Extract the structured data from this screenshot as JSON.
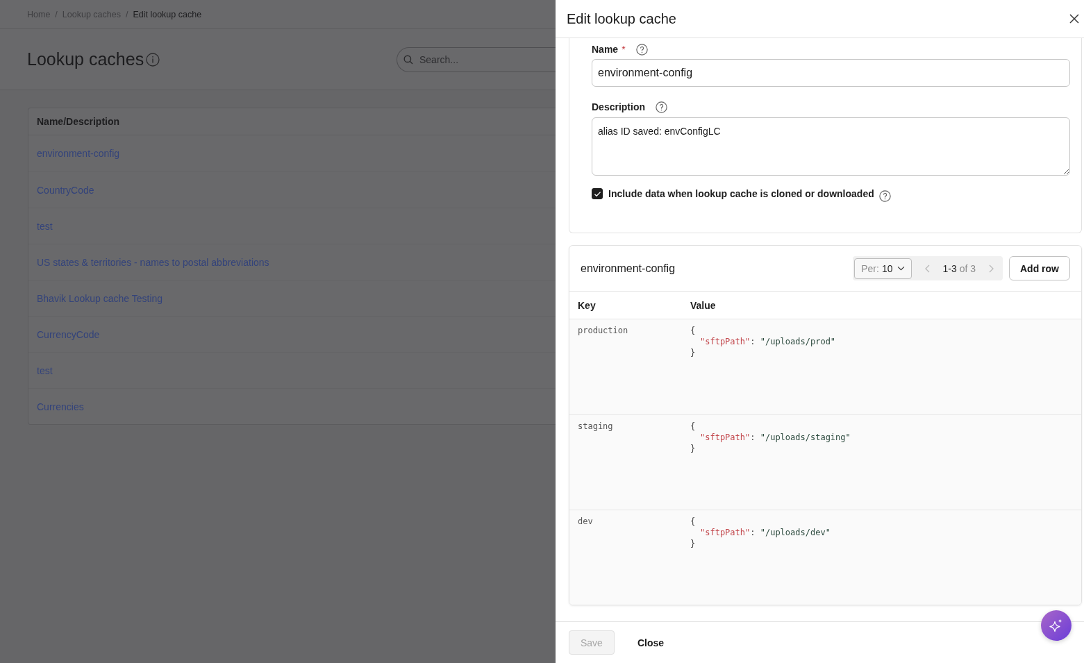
{
  "breadcrumb": {
    "items": [
      {
        "label": "Home",
        "current": false
      },
      {
        "separator": "/",
        "label": "Lookup caches",
        "current": false
      },
      {
        "separator": "/",
        "label": "Edit lookup cache",
        "current": true
      }
    ]
  },
  "page": {
    "title": "Lookup caches",
    "search": {
      "placeholder": "Search..."
    },
    "table": {
      "columns": [
        "Name/Description"
      ],
      "rows": [
        {
          "name": "environment-config"
        },
        {
          "name": "CountryCode"
        },
        {
          "name": "test"
        },
        {
          "name": "US states & territories - names to postal abbreviations"
        },
        {
          "name": "Bhavik Lookup cache Testing"
        },
        {
          "name": "CurrencyCode"
        },
        {
          "name": "test"
        },
        {
          "name": "Currencies"
        }
      ]
    }
  },
  "drawer": {
    "title": "Edit lookup cache",
    "form": {
      "name": {
        "label": "Name",
        "required_mark": "*",
        "value": "environment-config"
      },
      "description": {
        "label": "Description",
        "value": "alias ID saved: envConfigLC"
      },
      "include_data": {
        "label": "Include data when lookup cache is cloned or downloaded",
        "checked": true
      }
    },
    "data_table": {
      "title": "environment-config",
      "per_page": {
        "label": "Per:",
        "value": "10"
      },
      "pagination": {
        "range": "1-3",
        "total": "of 3",
        "prev_disabled": true,
        "next_disabled": true
      },
      "add_button": "Add row",
      "columns": [
        "Key",
        "Value"
      ],
      "rows": [
        {
          "key": "production",
          "value": {
            "open": "{",
            "entries": [
              {
                "key": "\"sftpPath\"",
                "colon": ":",
                "value": "\"/uploads/prod\""
              }
            ],
            "close": "}"
          }
        },
        {
          "key": "staging",
          "value": {
            "open": "{",
            "entries": [
              {
                "key": "\"sftpPath\"",
                "colon": ":",
                "value": "\"/uploads/staging\""
              }
            ],
            "close": "}"
          }
        },
        {
          "key": "dev",
          "value": {
            "open": "{",
            "entries": [
              {
                "key": "\"sftpPath\"",
                "colon": ":",
                "value": "\"/uploads/dev\""
              }
            ],
            "close": "}"
          }
        }
      ]
    },
    "footer": {
      "buttons": [
        {
          "kind": "primary",
          "label": "Save",
          "disabled": true
        },
        {
          "kind": "text",
          "label": "Close",
          "disabled": false
        }
      ]
    }
  }
}
